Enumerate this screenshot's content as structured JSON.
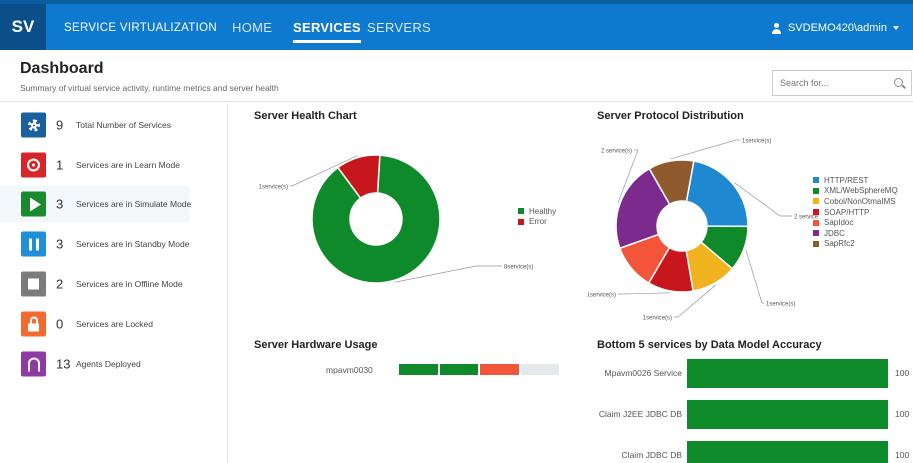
{
  "navbar": {
    "logo": "SV",
    "app_title": "SERVICE VIRTUALIZATION",
    "items": [
      {
        "label": "HOME",
        "active": false
      },
      {
        "label": "SERVICES",
        "active": true
      },
      {
        "label": "SERVERS",
        "active": false
      }
    ],
    "user": "SVDEMO420\\admin"
  },
  "header": {
    "title": "Dashboard",
    "subtitle": "Summary of virtual service activity, runtime metrics and server health",
    "search_placeholder": "Search for..."
  },
  "stats": [
    {
      "value": "9",
      "label": "Total Number of Services",
      "icon": "gear-icon",
      "color": "#1a5f9e"
    },
    {
      "value": "1",
      "label": "Services are in Learn Mode",
      "icon": "record-icon",
      "color": "#d9252a"
    },
    {
      "value": "3",
      "label": "Services are in Simulate Mode",
      "icon": "play-icon",
      "color": "#1a8a2e"
    },
    {
      "value": "3",
      "label": "Services are in Standby Mode",
      "icon": "pause-icon",
      "color": "#1e8fd8"
    },
    {
      "value": "2",
      "label": "Services are in Offline Mode",
      "icon": "stop-icon",
      "color": "#7b7b7b"
    },
    {
      "value": "0",
      "label": "Services are Locked",
      "icon": "lock-icon",
      "color": "#f26a2e"
    },
    {
      "value": "13",
      "label": "Agents Deployed",
      "icon": "agent-icon",
      "color": "#8e3aa5"
    }
  ],
  "chart_data": [
    {
      "type": "pie",
      "title": "Server Health Chart",
      "categories": [
        "Healthy",
        "Error"
      ],
      "values": [
        8,
        1
      ],
      "colors": [
        "#0e8a2a",
        "#c8161d"
      ],
      "slice_labels": [
        "8service(s)",
        "1service(s)"
      ],
      "legend_position": "right"
    },
    {
      "type": "pie",
      "title": "Server Protocol Distribution",
      "categories": [
        "HTTP/REST",
        "XML/WebSphereMQ",
        "Cobol/NonOtmaIMS",
        "SOAP/HTTP",
        "SapIdoc",
        "JDBC",
        "SapRfc2"
      ],
      "values": [
        2,
        1,
        1,
        1,
        1,
        2,
        1
      ],
      "colors": [
        "#1e88d0",
        "#0e8a2a",
        "#f0b21e",
        "#c8161d",
        "#f2553a",
        "#7d2a8f",
        "#8e5a2e"
      ],
      "slice_labels": [
        "2 service(s)",
        "1service(s)",
        "1service(s)",
        "1service(s)",
        "",
        "2 service(s)",
        "1service(s)"
      ],
      "legend_position": "right"
    },
    {
      "type": "bar",
      "title": "Server Hardware Usage",
      "categories": [
        "mpavm0030"
      ],
      "series": [
        {
          "values": [
            25
          ]
        },
        {
          "values": [
            25
          ]
        },
        {
          "values": [
            25
          ]
        },
        {
          "values": [
            25
          ]
        }
      ],
      "colors": [
        "#0e8a2a",
        "#0e8a2a",
        "#f2553a",
        "#e6e9ec"
      ]
    },
    {
      "type": "bar",
      "title": "Bottom 5 services by Data Model Accuracy",
      "categories": [
        "Mpavm0026 Service",
        "Claim J2EE JDBC DB",
        "Claim JDBC DB"
      ],
      "values": [
        100,
        100,
        100
      ],
      "value_labels": [
        "100",
        "100",
        "100"
      ],
      "colors": [
        "#0e8a2a"
      ]
    }
  ]
}
